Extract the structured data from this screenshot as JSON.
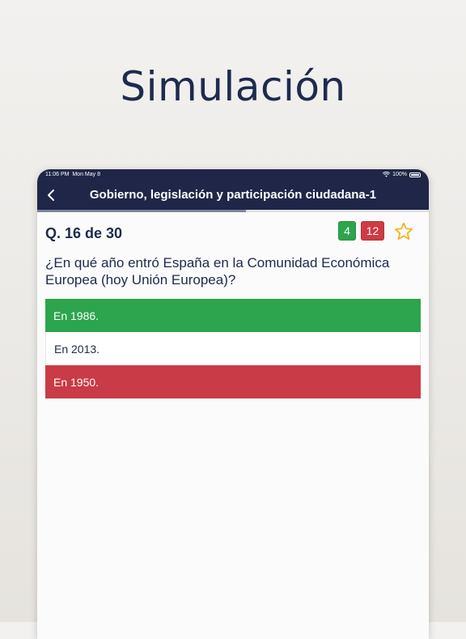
{
  "promo": {
    "title": "Simulación"
  },
  "status_bar": {
    "time": "11:06 PM",
    "date": "Mon May 8",
    "battery": "100%"
  },
  "nav": {
    "title": "Gobierno, legislación y participación ciudadana-1",
    "back_icon": "chevron-left-icon"
  },
  "progress": {
    "current": 16,
    "total": 30
  },
  "question_header": {
    "label": "Q. 16 de 30",
    "correct_count": "4",
    "wrong_count": "12",
    "favorite_icon": "star-outline-icon"
  },
  "question": {
    "text": "¿En qué año entró España en la Comunidad Económica Europea (hoy Unión Europea)?"
  },
  "answers": [
    {
      "text": "En 1986.",
      "state": "correct"
    },
    {
      "text": "En 2013.",
      "state": "neutral"
    },
    {
      "text": "En 1950.",
      "state": "wrong"
    }
  ],
  "colors": {
    "navy": "#1f2647",
    "correct": "#2da44e",
    "wrong": "#c93b46",
    "star": "#f2b21c"
  }
}
